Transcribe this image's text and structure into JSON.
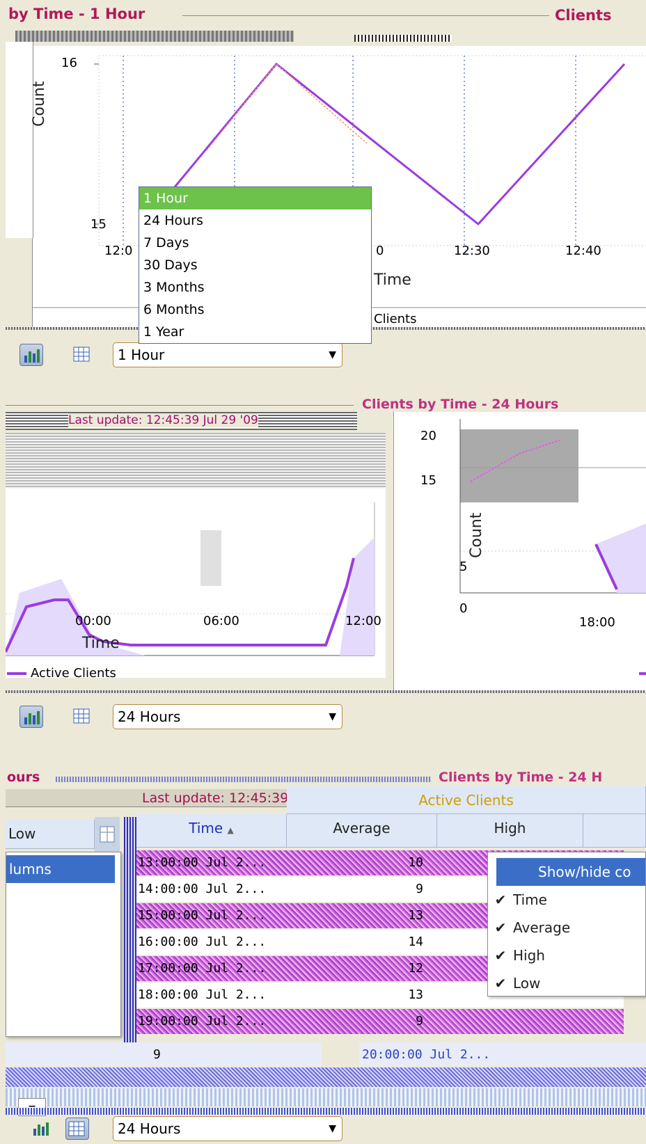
{
  "panel1": {
    "title": "by Time - 1 Hour",
    "right_title": "Clients",
    "y_axis_label": "Count",
    "y_ticks": [
      "16",
      "15"
    ],
    "x_ticks": [
      "12:0",
      "0",
      "12:30",
      "12:40"
    ],
    "x_axis_title": "Time",
    "legend_label": "Clients",
    "dropdown_options": [
      "1 Hour",
      "24 Hours",
      "7 Days",
      "30 Days",
      "3 Months",
      "6 Months",
      "1 Year"
    ],
    "selected_option": "1 Hour",
    "combo_value": "1 Hour",
    "colors": {
      "title": "#b0195a",
      "line": "#9b3ce0",
      "selected": "#6cc24a"
    }
  },
  "panel2": {
    "right_title": "Clients by Time - 24 Hours",
    "last_update_text": "Last update: 12:45:39 Jul 29 '09",
    "left_x_ticks": [
      "00:00",
      "06:00",
      "12:00"
    ],
    "x_axis_title": "Time",
    "legend_label": "Active Clients",
    "right_y_ticks": [
      "20",
      "15",
      "5",
      "0"
    ],
    "right_y_axis_label": "Count",
    "right_x_ticks": [
      "18:00"
    ],
    "combo_value": "24 Hours"
  },
  "panel3": {
    "left_title": "ours",
    "right_title": "Clients by Time - 24 H",
    "last_update_text": "Last update: 12:45:39 Jul 29 '09",
    "left_header": "Low",
    "left_menu_item": "lumns",
    "group_header": "Active Clients",
    "headers": {
      "time": "Time",
      "average": "Average",
      "high": "High"
    },
    "rows": [
      {
        "time": "13:00:00 Jul 2...",
        "average": "10"
      },
      {
        "time": "14:00:00 Jul 2...",
        "average": "9"
      },
      {
        "time": "15:00:00 Jul 2...",
        "average": "13"
      },
      {
        "time": "16:00:00 Jul 2...",
        "average": "14"
      },
      {
        "time": "17:00:00 Jul 2...",
        "average": "12"
      },
      {
        "time": "18:00:00 Jul 2...",
        "average": "13"
      },
      {
        "time": "19:00:00 Jul 2...",
        "average": "9"
      }
    ],
    "context_menu": [
      "Show/hide co",
      "Time",
      "Average",
      "High",
      "Low"
    ],
    "bottom_row": {
      "left_value": "9",
      "time": "20:00:00 Jul 2..."
    },
    "minus_label": "–",
    "combo_value": "24 Hours"
  }
}
